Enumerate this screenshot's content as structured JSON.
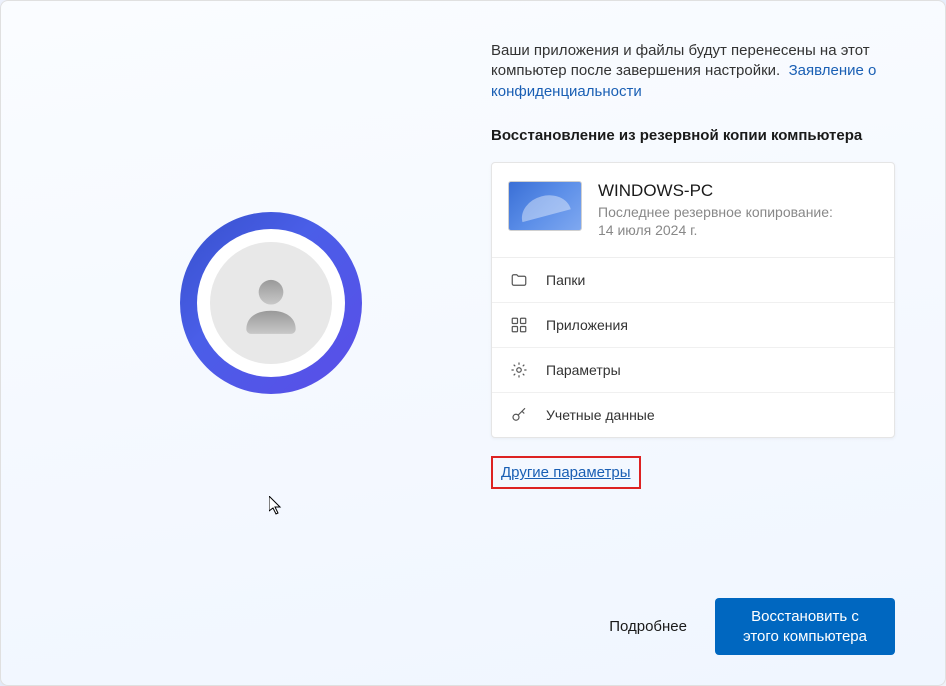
{
  "description": "Ваши приложения и файлы будут перенесены на этот компьютер после завершения настройки.",
  "privacy_link": "Заявление о конфиденциальности",
  "section_title": "Восстановление из резервной копии компьютера",
  "backup": {
    "pc_name": "WINDOWS-PC",
    "last_backup_label": "Последнее резервное копирование:",
    "last_backup_date": "14 июля 2024 г.",
    "items": {
      "folders": "Папки",
      "apps": "Приложения",
      "settings": "Параметры",
      "credentials": "Учетные данные"
    }
  },
  "other_options": "Другие параметры",
  "more_link": "Подробнее",
  "restore_button": "Восстановить с этого компьютера"
}
